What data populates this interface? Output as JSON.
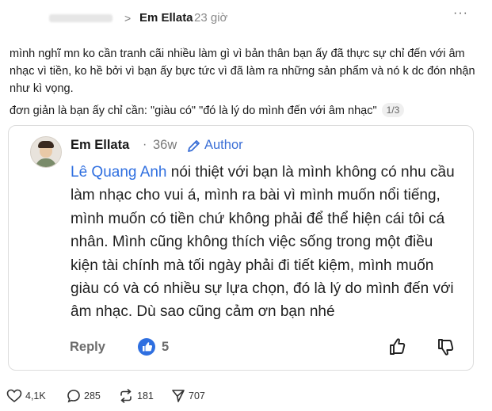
{
  "header": {
    "author": "Em Ellata",
    "time": "23 giờ",
    "separator": ">",
    "more": "···"
  },
  "post": {
    "paragraph1": "mình nghĩ mn ko cần tranh cãi nhiều làm gì vì bản thân bạn ấy đã thực sự chỉ đến với âm nhạc vì tiền, ko hề bởi vì bạn ấy bực tức vì đã làm ra những sản phẩm và nó k dc đón nhận như kì vọng.",
    "paragraph2": "đơn giản là bạn ấy chỉ cần: \"giàu có\" \"đó là lý do mình đến với âm nhạc\"",
    "image_counter": "1/3"
  },
  "comment": {
    "author": "Em Ellata",
    "dot": "·",
    "ago": "36w",
    "role": "Author",
    "mention": "Lê Quang Anh",
    "body": " nói thiệt với bạn là mình không có nhu cầu làm nhạc cho vui á, mình ra bài vì mình muốn nổi tiếng, mình muốn có tiền chứ không phải để thể hiện cái tôi cá nhân. Mình cũng không thích việc sống trong một điều kiện tài chính mà tối ngày phải đi tiết kiệm, mình muốn giàu có và có nhiều sự lựa chọn, đó là lý do mình đến với âm nhạc. Dù sao cũng cảm ơn bạn nhé",
    "reply_label": "Reply",
    "like_count": "5",
    "icons": {
      "like": "like-icon",
      "upvote": "thumbs-up-icon",
      "downvote": "thumbs-down-icon",
      "edit": "pencil-icon"
    },
    "colors": {
      "accent": "#2f6fe0"
    }
  },
  "footer": {
    "likes": "4,1K",
    "comments": "285",
    "reposts": "181",
    "shares": "707"
  }
}
